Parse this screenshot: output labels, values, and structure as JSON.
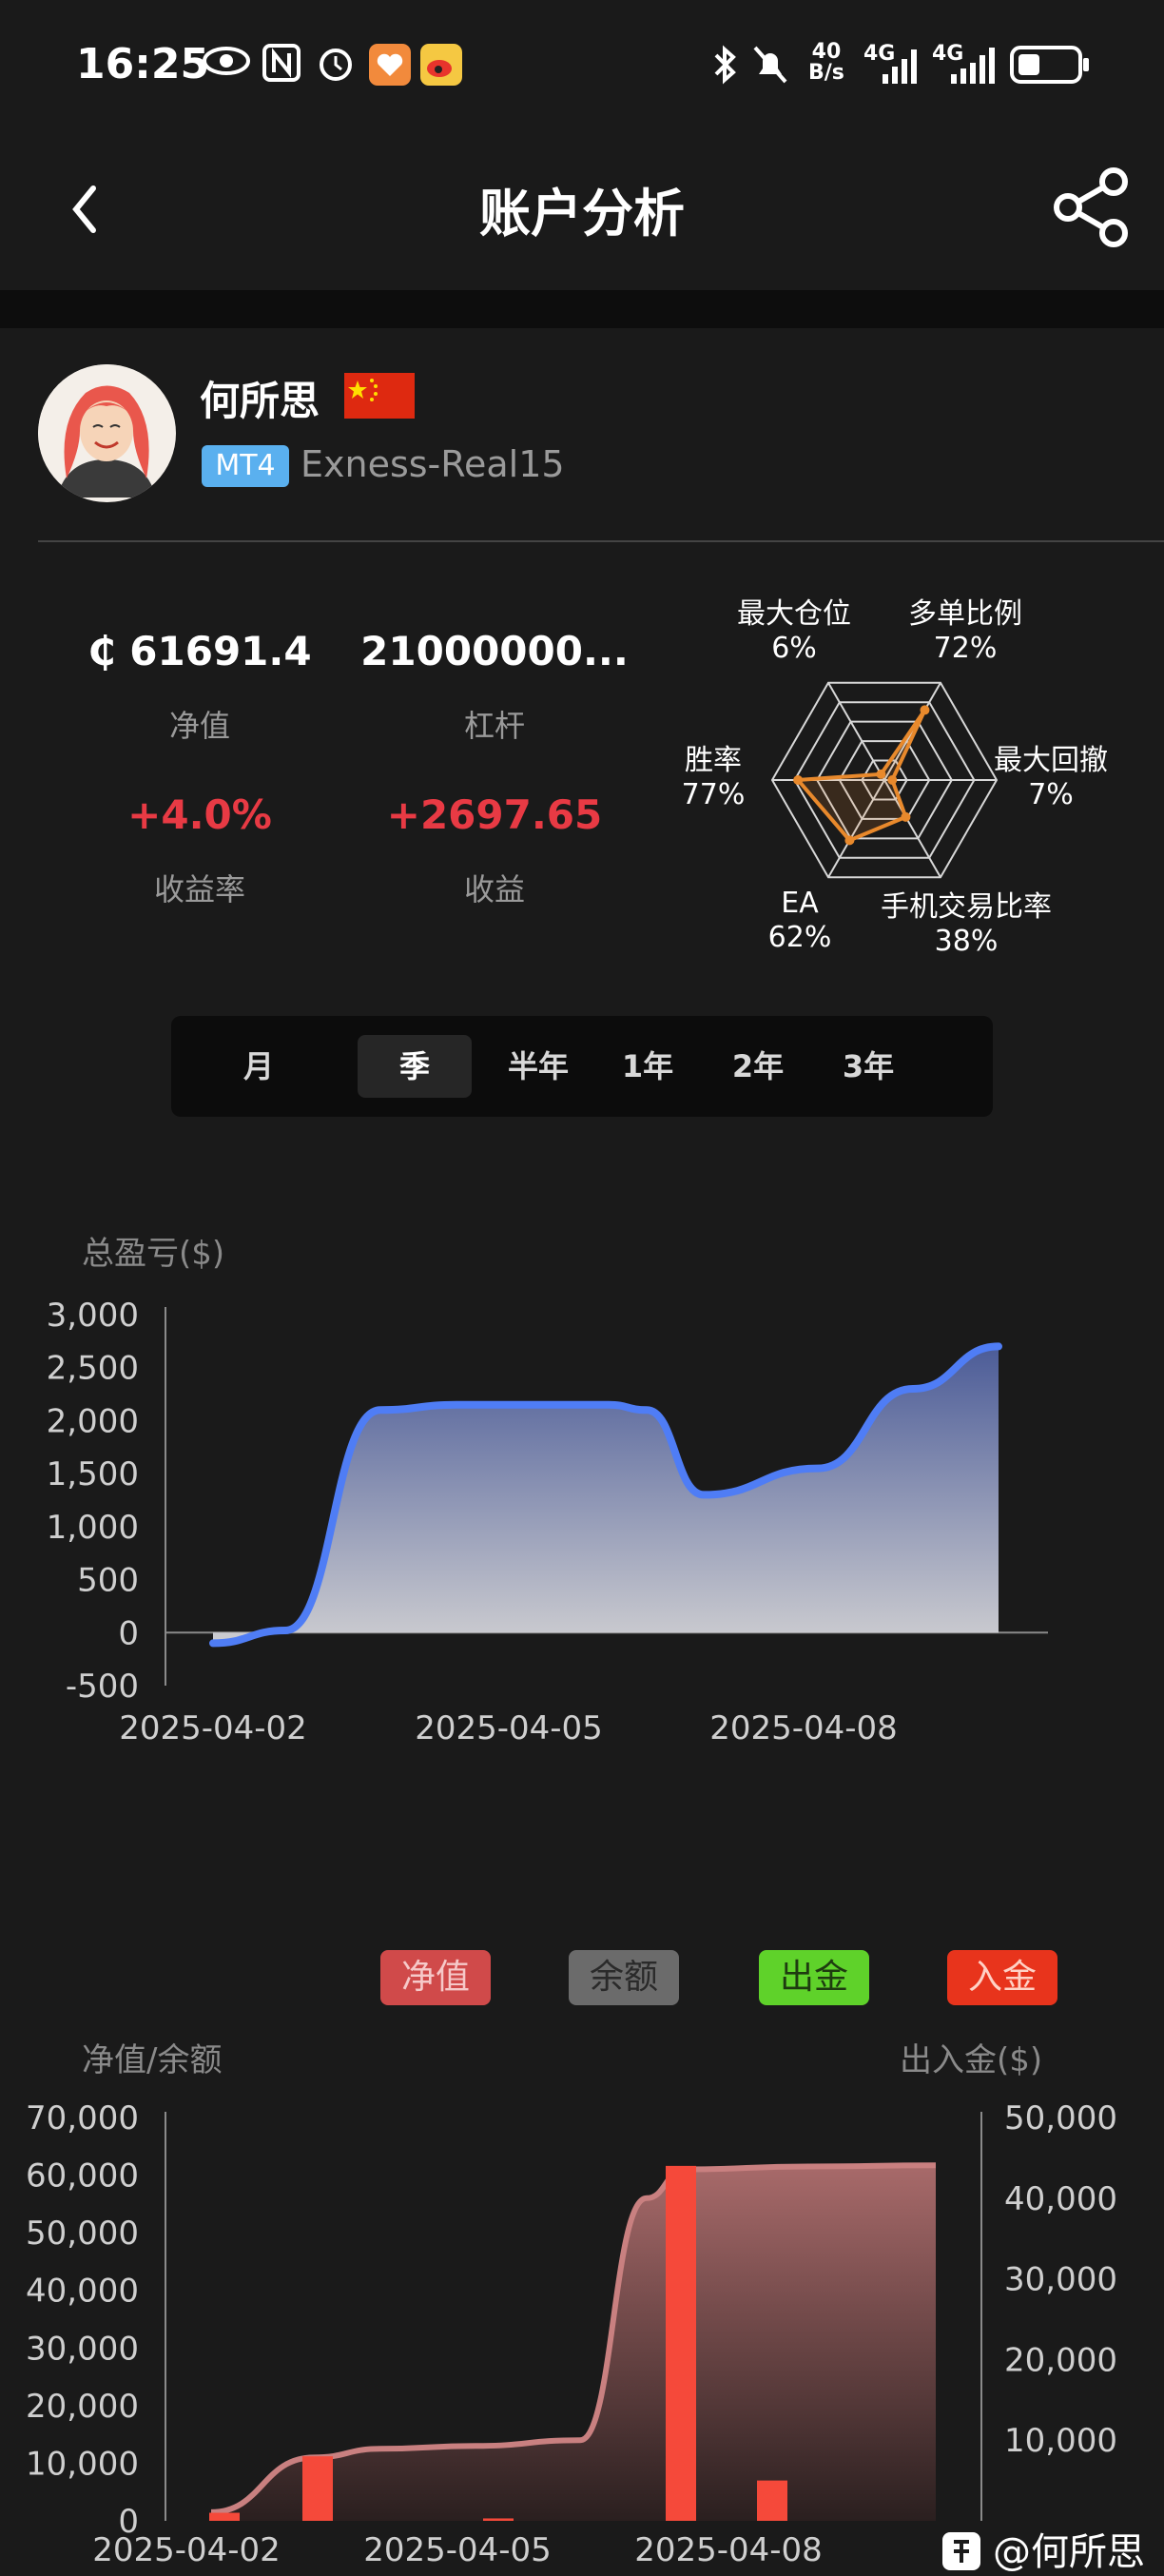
{
  "status_bar": {
    "time": "16:25",
    "net_speed_top": "40",
    "net_speed_bottom": "B/s",
    "signal1": "4G",
    "signal2": "4G"
  },
  "header": {
    "title": "账户分析",
    "icons": [
      "back-icon",
      "share-icon"
    ]
  },
  "profile": {
    "name": "何所思",
    "platform_badge": "MT4",
    "server": "Exness-Real15",
    "flag": "china-flag"
  },
  "stats": [
    {
      "value": "₵ 61691.4",
      "label": "净值"
    },
    {
      "value": "21000000...",
      "label": "杠杆"
    },
    {
      "value": "+4.0%",
      "label": "收益率"
    },
    {
      "value": "+2697.65",
      "label": "收益"
    }
  ],
  "radar": {
    "axes": [
      {
        "name": "多单比例",
        "value": "72%"
      },
      {
        "name": "最大回撤",
        "value": "7%"
      },
      {
        "name": "手机交易比率",
        "value": "38%"
      },
      {
        "name": "EA",
        "value": "62%"
      },
      {
        "name": "胜率",
        "value": "77%"
      },
      {
        "name": "最大仓位",
        "value": "6%"
      }
    ],
    "color": "#e8892c"
  },
  "tabs": {
    "items": [
      "月",
      "季",
      "半年",
      "1年",
      "2年",
      "3年"
    ],
    "active": "季"
  },
  "chart_data": [
    {
      "type": "area",
      "ylabel": "总盈亏($)",
      "ylim": [
        -500,
        3000
      ],
      "yticks": [
        "3,000",
        "2,500",
        "2,000",
        "1,500",
        "1,000",
        "500",
        "0",
        "-500"
      ],
      "xticks": [
        "2025-04-02",
        "2025-04-05",
        "2025-04-08"
      ],
      "x": [
        "2025-04-02",
        "2025-04-03",
        "2025-04-03",
        "2025-04-04",
        "2025-04-05",
        "2025-04-06",
        "2025-04-07",
        "2025-04-08",
        "2025-04-09",
        "2025-04-10"
      ],
      "series": [
        {
          "values": [
            -100,
            20,
            2100,
            2150,
            2150,
            2100,
            1300,
            1550,
            2300,
            2700
          ]
        }
      ],
      "color": "#4f7df5"
    },
    {
      "type": "bar",
      "legend": [
        {
          "name": "净值",
          "color": "#e05252"
        },
        {
          "name": "余额",
          "color": "#6b6b6b"
        },
        {
          "name": "出金",
          "color": "#5fd22a"
        },
        {
          "name": "入金",
          "color": "#e8341c"
        }
      ],
      "ylabel_left": "净值/余额",
      "ylabel_right": "出入金($)",
      "ylim_left": [
        0,
        70000
      ],
      "ylim_right": [
        0,
        50000
      ],
      "yticks_left": [
        "70,000",
        "60,000",
        "50,000",
        "40,000",
        "30,000",
        "20,000",
        "10,000",
        "0"
      ],
      "yticks_right": [
        "50,000",
        "40,000",
        "30,000",
        "20,000",
        "10,000"
      ],
      "xticks": [
        "2025-04-02",
        "2025-04-05",
        "2025-04-08"
      ],
      "series": [
        {
          "name": "入金",
          "x": [
            "2025-04-02",
            "2025-04-03",
            "2025-04-05",
            "2025-04-07",
            "2025-04-08"
          ],
          "values": [
            1000,
            8000,
            300,
            44000,
            5000
          ]
        },
        {
          "name": "净值",
          "x": [
            "2025-04-02",
            "2025-04-03",
            "2025-04-04",
            "2025-04-05",
            "2025-04-06",
            "2025-04-07",
            "2025-04-08",
            "2025-04-09",
            "2025-04-10"
          ],
          "values": [
            1500,
            11000,
            12500,
            13000,
            14000,
            56000,
            61000,
            61500,
            61700
          ]
        }
      ]
    }
  ],
  "watermark": "@何所思"
}
